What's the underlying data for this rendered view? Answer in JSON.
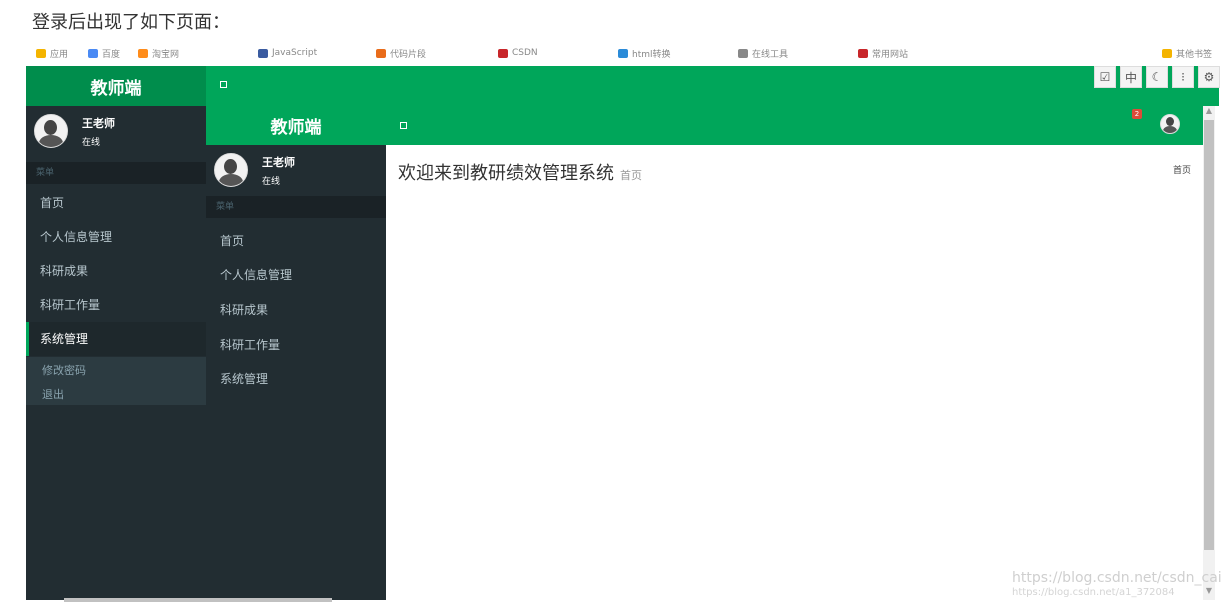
{
  "caption": "登录后出现了如下页面：",
  "bookmarks": [
    {
      "label": "应用",
      "color": "#f4b400"
    },
    {
      "label": "百度",
      "color": "#4a8af4"
    },
    {
      "label": "淘宝网",
      "color": "#ff8c1a"
    },
    {
      "label": "JavaScript",
      "color": "#3a5ba0"
    },
    {
      "label": "代码片段",
      "color": "#e96c1a"
    },
    {
      "label": "CSDN",
      "color": "#c8262a"
    },
    {
      "label": "html转换",
      "color": "#2b8bd8"
    },
    {
      "label": "在线工具",
      "color": "#888888"
    },
    {
      "label": "常用网站",
      "color": "#c8262a"
    },
    {
      "label": "其他书签",
      "color": "#f4b400"
    }
  ],
  "toolbar": [
    "shield",
    "中",
    "moon",
    "dots",
    "gear"
  ],
  "outer": {
    "logo": "教师端",
    "user": {
      "name": "王老师",
      "status": "在线"
    },
    "menu_header": "菜单",
    "menu": [
      "首页",
      "个人信息管理",
      "科研成果",
      "科研工作量",
      "系统管理"
    ],
    "submenu": [
      "修改密码",
      "退出"
    ]
  },
  "inner": {
    "logo": "教师端",
    "user": {
      "name": "王老师",
      "status": "在线"
    },
    "menu_header": "菜单",
    "menu": [
      "首页",
      "个人信息管理",
      "科研成果",
      "科研工作量",
      "系统管理"
    ],
    "notification_count": "2",
    "page_title": "欢迎来到教研绩效管理系统",
    "page_subtitle": "首页",
    "breadcrumb": "首页"
  },
  "scrollbar": {
    "up": "▲",
    "down": "▼"
  },
  "watermark": "https://blog.csdn.net/csdn_cai",
  "watermark2": "https://blog.csdn.net/a1_372084"
}
